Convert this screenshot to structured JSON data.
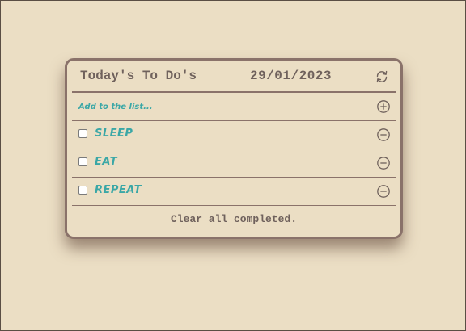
{
  "header": {
    "title": "Today's To Do's",
    "date": "29/01/2023",
    "refresh_icon": "refresh-icon"
  },
  "add_field": {
    "placeholder": "Add to the list...",
    "add_icon": "plus-circle-icon"
  },
  "items": [
    {
      "label": "SLEEP",
      "checked": false,
      "remove_icon": "minus-circle-icon"
    },
    {
      "label": "EAT",
      "checked": false,
      "remove_icon": "minus-circle-icon"
    },
    {
      "label": "REPEAT",
      "checked": false,
      "remove_icon": "minus-circle-icon"
    }
  ],
  "footer": {
    "clear_label": "Clear all completed."
  },
  "colors": {
    "background": "#ebdec4",
    "border": "#8a726a",
    "heading_text": "#6f615c",
    "accent_text": "#3aa7a6"
  }
}
